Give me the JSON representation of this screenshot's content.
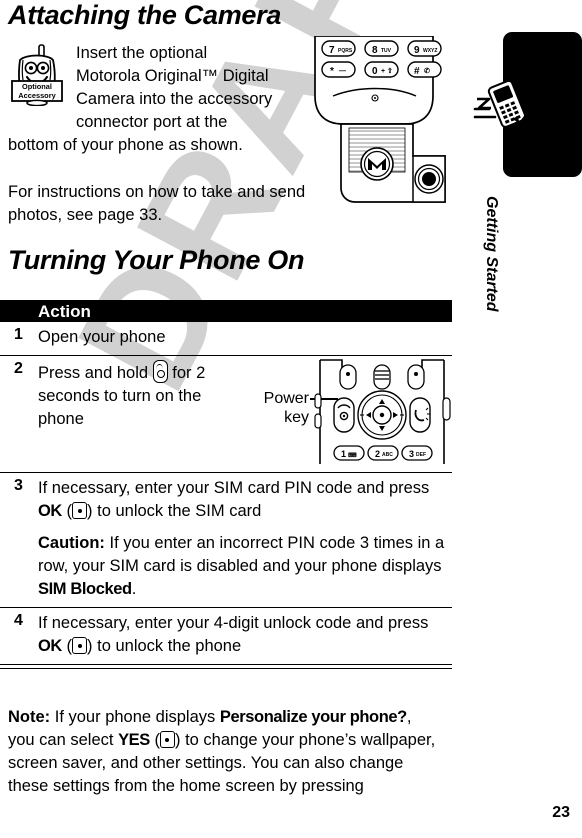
{
  "page": {
    "number": "23",
    "watermark": "DRAFT",
    "sidebar": {
      "label": "Getting Started",
      "icon": "running-phone-icon"
    }
  },
  "sections": [
    {
      "heading": "Attaching the Camera",
      "icon": {
        "name": "optional-accessory-icon",
        "line1": "Optional",
        "line2": "Accessory"
      },
      "paragraphs": [
        {
          "indented_lines": [
            "Insert the optional",
            "Motorola Original™ Digital",
            "Camera into the accessory",
            "connector port at the"
          ],
          "full_lines": [
            "bottom of your phone as shown."
          ]
        },
        {
          "text": "For instructions on how to take and send photos, see page 33."
        }
      ],
      "illustration": "camera-attachment-illustration"
    },
    {
      "heading": "Turning Your Phone On"
    }
  ],
  "table": {
    "header": "Action",
    "rows": [
      {
        "num": "1",
        "text_before": "Open your phone",
        "text_after": ""
      },
      {
        "num": "2",
        "text_before": "Press and hold ",
        "key_glyph": "power-key-glyph",
        "text_after": " for 2 seconds to turn on the phone",
        "callout": {
          "line1": "Power",
          "line2": "key"
        },
        "illustration": "keypad-illustration"
      },
      {
        "num": "3",
        "part1": "If necessary, enter your SIM card PIN code and press ",
        "softkey": "OK",
        "part2": " (",
        "key_glyph": "center-select-key-glyph",
        "part3": ") to unlock the SIM card",
        "caution_label": "Caution:",
        "caution_part1": " If you enter an incorrect PIN code 3 times in a row, your SIM card is disabled and your phone displays ",
        "caution_display": "SIM Blocked",
        "caution_part2": "."
      },
      {
        "num": "4",
        "part1": "If necessary, enter your 4-digit unlock code and press ",
        "softkey": "OK",
        "part2": " (",
        "key_glyph": "center-select-key-glyph",
        "part3": ") to unlock the phone"
      }
    ]
  },
  "note": {
    "label": "Note:",
    "part1": " If your phone displays ",
    "display1": "Personalize your phone?",
    "part2": ", you can select ",
    "softkey": "YES",
    "part3": " (",
    "key_glyph": "center-select-key-glyph",
    "part4": ") to change your phone’s wallpaper, screen saver, and other settings. You can also change these settings from the home screen by pressing"
  },
  "colors": {
    "text": "#000000",
    "header_bar": "#000000",
    "header_text": "#ffffff",
    "watermark": "#c9c9c9",
    "sidebar_tab": "#000000"
  }
}
